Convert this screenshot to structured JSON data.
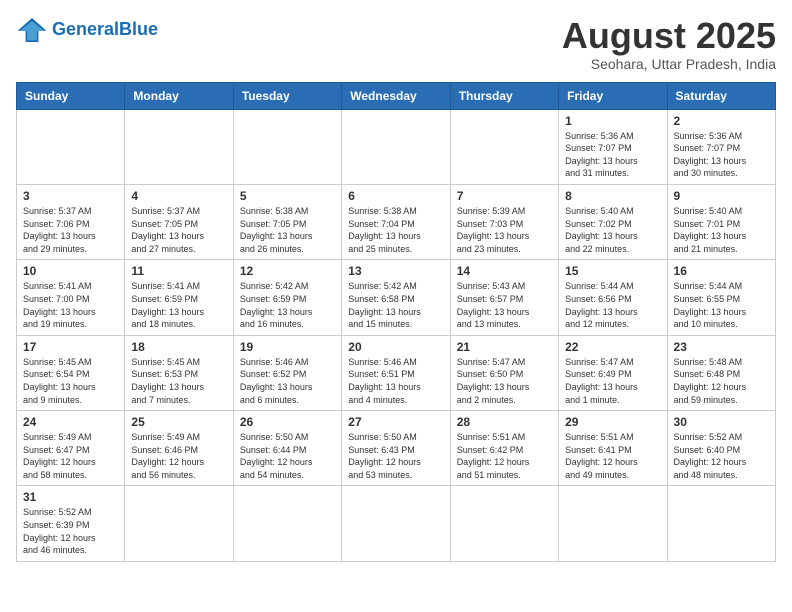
{
  "header": {
    "logo_general": "General",
    "logo_blue": "Blue",
    "month_title": "August 2025",
    "subtitle": "Seohara, Uttar Pradesh, India"
  },
  "weekdays": [
    "Sunday",
    "Monday",
    "Tuesday",
    "Wednesday",
    "Thursday",
    "Friday",
    "Saturday"
  ],
  "weeks": [
    [
      {
        "day": "",
        "info": ""
      },
      {
        "day": "",
        "info": ""
      },
      {
        "day": "",
        "info": ""
      },
      {
        "day": "",
        "info": ""
      },
      {
        "day": "",
        "info": ""
      },
      {
        "day": "1",
        "info": "Sunrise: 5:36 AM\nSunset: 7:07 PM\nDaylight: 13 hours\nand 31 minutes."
      },
      {
        "day": "2",
        "info": "Sunrise: 5:36 AM\nSunset: 7:07 PM\nDaylight: 13 hours\nand 30 minutes."
      }
    ],
    [
      {
        "day": "3",
        "info": "Sunrise: 5:37 AM\nSunset: 7:06 PM\nDaylight: 13 hours\nand 29 minutes."
      },
      {
        "day": "4",
        "info": "Sunrise: 5:37 AM\nSunset: 7:05 PM\nDaylight: 13 hours\nand 27 minutes."
      },
      {
        "day": "5",
        "info": "Sunrise: 5:38 AM\nSunset: 7:05 PM\nDaylight: 13 hours\nand 26 minutes."
      },
      {
        "day": "6",
        "info": "Sunrise: 5:38 AM\nSunset: 7:04 PM\nDaylight: 13 hours\nand 25 minutes."
      },
      {
        "day": "7",
        "info": "Sunrise: 5:39 AM\nSunset: 7:03 PM\nDaylight: 13 hours\nand 23 minutes."
      },
      {
        "day": "8",
        "info": "Sunrise: 5:40 AM\nSunset: 7:02 PM\nDaylight: 13 hours\nand 22 minutes."
      },
      {
        "day": "9",
        "info": "Sunrise: 5:40 AM\nSunset: 7:01 PM\nDaylight: 13 hours\nand 21 minutes."
      }
    ],
    [
      {
        "day": "10",
        "info": "Sunrise: 5:41 AM\nSunset: 7:00 PM\nDaylight: 13 hours\nand 19 minutes."
      },
      {
        "day": "11",
        "info": "Sunrise: 5:41 AM\nSunset: 6:59 PM\nDaylight: 13 hours\nand 18 minutes."
      },
      {
        "day": "12",
        "info": "Sunrise: 5:42 AM\nSunset: 6:59 PM\nDaylight: 13 hours\nand 16 minutes."
      },
      {
        "day": "13",
        "info": "Sunrise: 5:42 AM\nSunset: 6:58 PM\nDaylight: 13 hours\nand 15 minutes."
      },
      {
        "day": "14",
        "info": "Sunrise: 5:43 AM\nSunset: 6:57 PM\nDaylight: 13 hours\nand 13 minutes."
      },
      {
        "day": "15",
        "info": "Sunrise: 5:44 AM\nSunset: 6:56 PM\nDaylight: 13 hours\nand 12 minutes."
      },
      {
        "day": "16",
        "info": "Sunrise: 5:44 AM\nSunset: 6:55 PM\nDaylight: 13 hours\nand 10 minutes."
      }
    ],
    [
      {
        "day": "17",
        "info": "Sunrise: 5:45 AM\nSunset: 6:54 PM\nDaylight: 13 hours\nand 9 minutes."
      },
      {
        "day": "18",
        "info": "Sunrise: 5:45 AM\nSunset: 6:53 PM\nDaylight: 13 hours\nand 7 minutes."
      },
      {
        "day": "19",
        "info": "Sunrise: 5:46 AM\nSunset: 6:52 PM\nDaylight: 13 hours\nand 6 minutes."
      },
      {
        "day": "20",
        "info": "Sunrise: 5:46 AM\nSunset: 6:51 PM\nDaylight: 13 hours\nand 4 minutes."
      },
      {
        "day": "21",
        "info": "Sunrise: 5:47 AM\nSunset: 6:50 PM\nDaylight: 13 hours\nand 2 minutes."
      },
      {
        "day": "22",
        "info": "Sunrise: 5:47 AM\nSunset: 6:49 PM\nDaylight: 13 hours\nand 1 minute."
      },
      {
        "day": "23",
        "info": "Sunrise: 5:48 AM\nSunset: 6:48 PM\nDaylight: 12 hours\nand 59 minutes."
      }
    ],
    [
      {
        "day": "24",
        "info": "Sunrise: 5:49 AM\nSunset: 6:47 PM\nDaylight: 12 hours\nand 58 minutes."
      },
      {
        "day": "25",
        "info": "Sunrise: 5:49 AM\nSunset: 6:46 PM\nDaylight: 12 hours\nand 56 minutes."
      },
      {
        "day": "26",
        "info": "Sunrise: 5:50 AM\nSunset: 6:44 PM\nDaylight: 12 hours\nand 54 minutes."
      },
      {
        "day": "27",
        "info": "Sunrise: 5:50 AM\nSunset: 6:43 PM\nDaylight: 12 hours\nand 53 minutes."
      },
      {
        "day": "28",
        "info": "Sunrise: 5:51 AM\nSunset: 6:42 PM\nDaylight: 12 hours\nand 51 minutes."
      },
      {
        "day": "29",
        "info": "Sunrise: 5:51 AM\nSunset: 6:41 PM\nDaylight: 12 hours\nand 49 minutes."
      },
      {
        "day": "30",
        "info": "Sunrise: 5:52 AM\nSunset: 6:40 PM\nDaylight: 12 hours\nand 48 minutes."
      }
    ],
    [
      {
        "day": "31",
        "info": "Sunrise: 5:52 AM\nSunset: 6:39 PM\nDaylight: 12 hours\nand 46 minutes."
      },
      {
        "day": "",
        "info": ""
      },
      {
        "day": "",
        "info": ""
      },
      {
        "day": "",
        "info": ""
      },
      {
        "day": "",
        "info": ""
      },
      {
        "day": "",
        "info": ""
      },
      {
        "day": "",
        "info": ""
      }
    ]
  ]
}
